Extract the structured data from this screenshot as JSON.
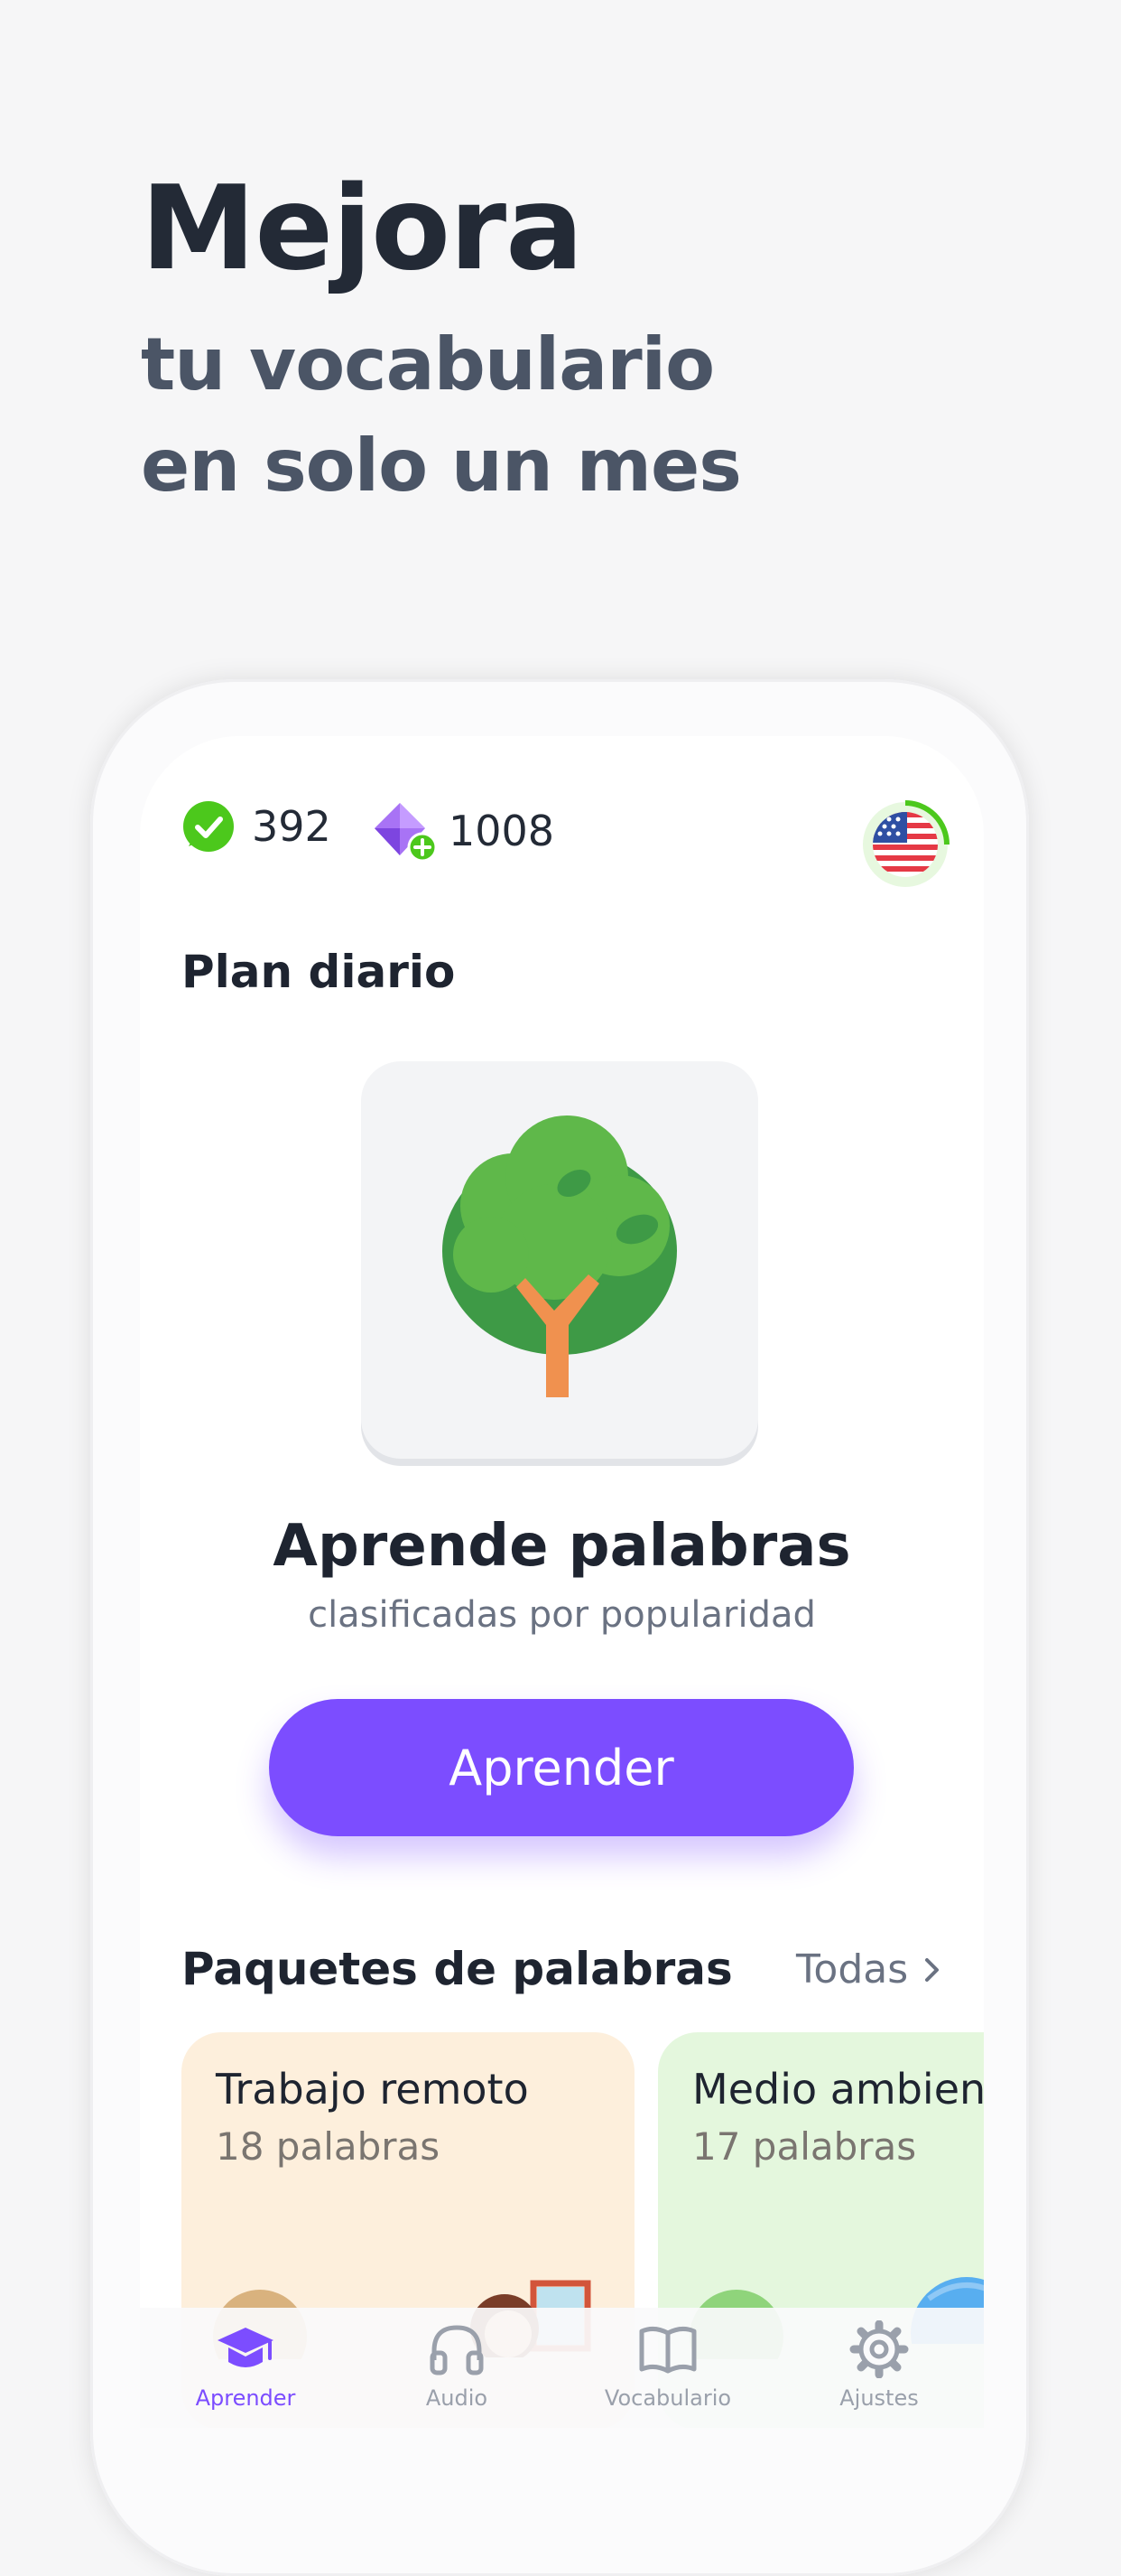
{
  "headline": {
    "title": "Mejora",
    "line1": "tu vocabulario",
    "line2": "en solo un mes"
  },
  "stats": {
    "checks": "392",
    "gems": "1008"
  },
  "plan": {
    "title": "Plan diario",
    "card_title": "Aprende palabras",
    "card_subtitle": "clasificadas por popularidad",
    "button": "Aprender"
  },
  "packs": {
    "title": "Paquetes de palabras",
    "all_link": "Todas",
    "items": [
      {
        "title": "Trabajo remoto",
        "count": "18 palabras",
        "color": "#fdefdc"
      },
      {
        "title": "Medio ambiente",
        "count": "17 palabras",
        "color": "#e4f7dd"
      }
    ]
  },
  "tabs": [
    {
      "label": "Aprender",
      "icon": "graduation-cap-icon",
      "active": true
    },
    {
      "label": "Audio",
      "icon": "headphones-icon",
      "active": false
    },
    {
      "label": "Vocabulario",
      "icon": "book-icon",
      "active": false
    },
    {
      "label": "Ajustes",
      "icon": "gear-icon",
      "active": false
    }
  ],
  "colors": {
    "accent": "#7c4dff",
    "success": "#4cc81c",
    "text_dark": "#232a36"
  }
}
